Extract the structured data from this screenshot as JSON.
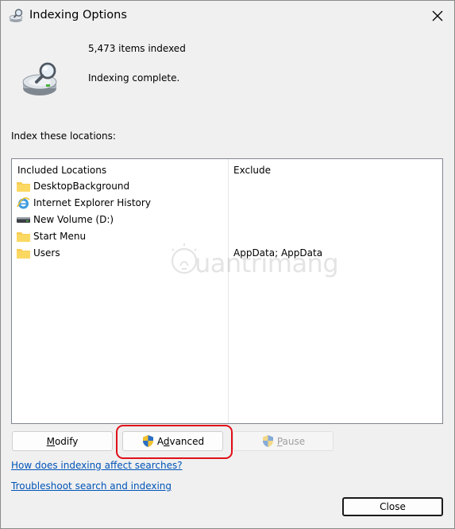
{
  "window": {
    "title": "Indexing Options",
    "title_icon": "indexing-options-icon",
    "close_icon": "close-icon"
  },
  "status": {
    "items_indexed": "5,473 items indexed",
    "state": "Indexing complete."
  },
  "locations": {
    "label": "Index these locations:",
    "columns": {
      "included": "Included Locations",
      "exclude": "Exclude"
    },
    "rows": [
      {
        "name": "DesktopBackground",
        "exclude": "",
        "icon": "folder-icon"
      },
      {
        "name": "Internet Explorer History",
        "exclude": "",
        "icon": "internet-explorer-icon"
      },
      {
        "name": "New Volume (D:)",
        "exclude": "",
        "icon": "drive-icon"
      },
      {
        "name": "Start Menu",
        "exclude": "",
        "icon": "folder-icon"
      },
      {
        "name": "Users",
        "exclude": "AppData; AppData",
        "icon": "folder-icon"
      }
    ]
  },
  "watermark": {
    "text": "uantrimang",
    "icon": "lightbulb-icon"
  },
  "buttons": {
    "modify": {
      "before": "",
      "mnemonic": "M",
      "after": "odify"
    },
    "advanced": {
      "before": "A",
      "mnemonic": "d",
      "after": "vanced"
    },
    "pause": {
      "before": "",
      "mnemonic": "P",
      "after": "ause"
    },
    "close": "Close"
  },
  "links": {
    "indexing_affects": "How does indexing affect searches?",
    "troubleshoot": "Troubleshoot search and indexing"
  },
  "colors": {
    "link": "#0054b8",
    "highlight": "#e0101a",
    "folder": "#f8cd55"
  }
}
